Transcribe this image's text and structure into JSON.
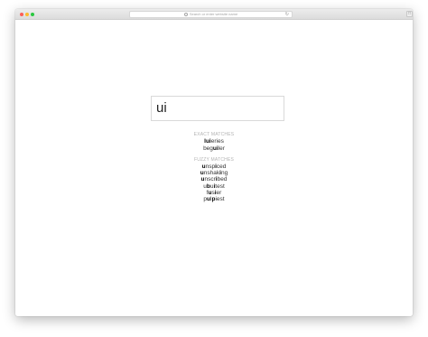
{
  "browser": {
    "address_placeholder": "Search or enter website name"
  },
  "search": {
    "value": "ui"
  },
  "exact": {
    "title": "EXACT MATCHES",
    "items": [
      {
        "pre": "",
        "hl": "lui",
        "post": "eries"
      },
      {
        "pre": "beg",
        "hl": "ui",
        "post": "ler"
      }
    ]
  },
  "fuzzy": {
    "title": "FUZZY MATCHES",
    "items": [
      {
        "parts": [
          [
            "u",
            true
          ],
          [
            "nsp",
            false
          ],
          [
            "i",
            true
          ],
          [
            "ced",
            false
          ]
        ]
      },
      {
        "parts": [
          [
            "u",
            true
          ],
          [
            "nshak",
            false
          ],
          [
            "i",
            true
          ],
          [
            "ng",
            false
          ]
        ]
      },
      {
        "parts": [
          [
            "u",
            true
          ],
          [
            "nscr",
            false
          ],
          [
            "i",
            true
          ],
          [
            "bed",
            false
          ]
        ]
      },
      {
        "parts": [
          [
            "u",
            false
          ],
          [
            "b",
            true
          ],
          [
            "u",
            false
          ],
          [
            "i",
            true
          ],
          [
            "test",
            false
          ]
        ]
      },
      {
        "parts": [
          [
            "f",
            false
          ],
          [
            "u",
            true
          ],
          [
            "s",
            false
          ],
          [
            "i",
            true
          ],
          [
            "er",
            false
          ]
        ]
      },
      {
        "parts": [
          [
            "p",
            false
          ],
          [
            "u",
            true
          ],
          [
            "l",
            false
          ],
          [
            "p",
            true
          ],
          [
            "iest",
            false
          ]
        ]
      }
    ]
  }
}
